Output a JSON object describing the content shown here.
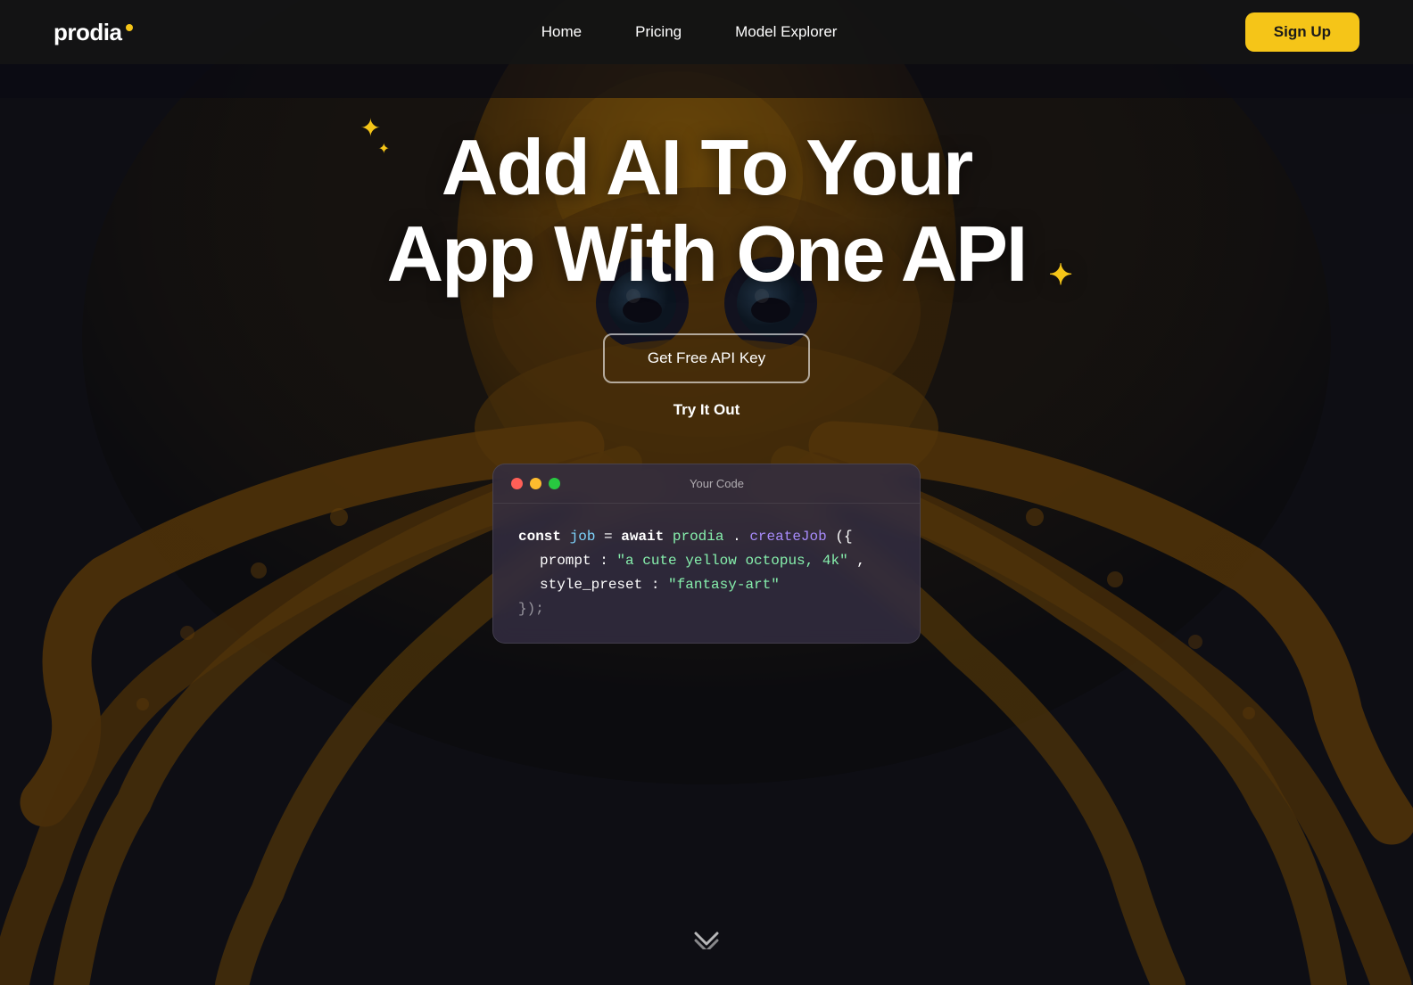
{
  "nav": {
    "logo_text": "prodia",
    "links": [
      {
        "id": "home",
        "label": "Home",
        "href": "#"
      },
      {
        "id": "pricing",
        "label": "Pricing",
        "href": "#"
      },
      {
        "id": "model-explorer",
        "label": "Model Explorer",
        "href": "#"
      }
    ],
    "signup_label": "Sign Up"
  },
  "hero": {
    "title_line1": "Add AI To Your",
    "title_line2": "App With One API",
    "cta_primary": "Get Free API Key",
    "cta_secondary": "Try It Out",
    "code_window": {
      "title": "Your Code",
      "line1_keyword": "const",
      "line1_var": "job",
      "line1_op": "=",
      "line1_await": "await",
      "line1_call": "prodia.createJob({",
      "line2_key": "prompt:",
      "line2_val": "\"a cute yellow octopus, 4k\",",
      "line3_key": "style_preset:",
      "line3_val": "\"fantasy-art\"",
      "line4_close": "});"
    }
  }
}
